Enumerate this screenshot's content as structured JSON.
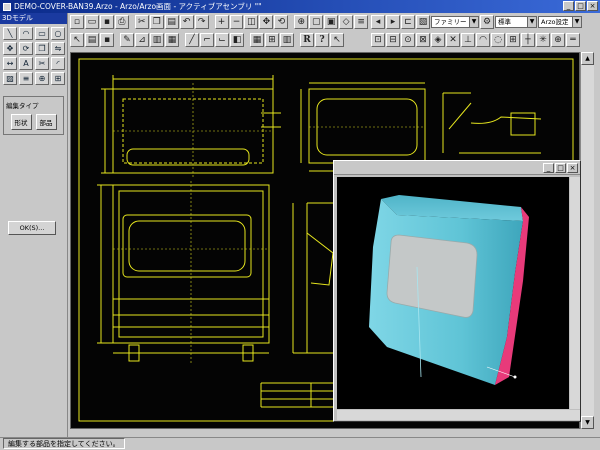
{
  "window": {
    "title": "DEMO-COVER-BAN39.Arzo - Arzo/Arzo画面 - アクティブアセンブリ \"\"",
    "buttons": [
      "_",
      "□",
      "×"
    ]
  },
  "palette": {
    "title": "3Dモデル",
    "group_title": "編集タイプ",
    "group_buttons": [
      "形状",
      "部品"
    ],
    "extra_button": "OK(S)..."
  },
  "toolbar": {
    "r_label": "R",
    "help_label": "?",
    "combo1": "ファミリー",
    "combo2": "標準",
    "combo3": "Arzo設定"
  },
  "status": {
    "message": "編集する部品を指定してください。"
  },
  "colors": {
    "drawing": "#e6e61e",
    "drawing_dim": "#d8d820",
    "canvas": "#040404",
    "model": "#5fc4d6",
    "model_edge": "#e83a7a",
    "window_face": "#c9c9c9"
  },
  "icons": {
    "palette": [
      "line-icon",
      "arc-icon",
      "rect-icon",
      "circle-icon",
      "move-icon",
      "rotate-icon",
      "copy-icon",
      "mirror-icon",
      "dim-icon",
      "text-icon",
      "trim-icon",
      "fillet-icon",
      "hatch-icon",
      "layer-icon",
      "snap-icon",
      "grid-icon"
    ]
  }
}
